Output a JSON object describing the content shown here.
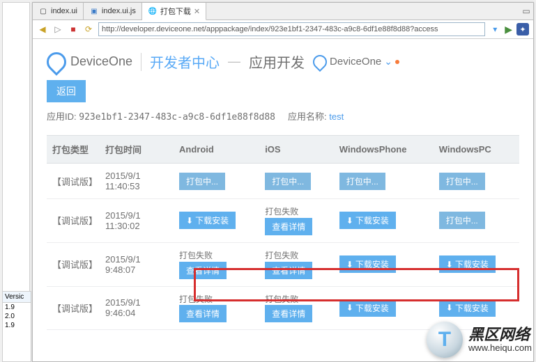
{
  "tabs": [
    {
      "label": "index.ui",
      "icon": "📄",
      "active": false
    },
    {
      "label": "index.ui.js",
      "icon": "📘",
      "active": false
    },
    {
      "label": "打包下载",
      "icon": "🌐",
      "active": true,
      "closable": true
    }
  ],
  "toolbar": {
    "url": "http://developer.deviceone.net/apppackage/index/923e1bf1-2347-483c-a9c8-6df1e88f8d88?access"
  },
  "header": {
    "brand": "DeviceOne",
    "dev_center": "开发者中心",
    "app_dev": "应用开发",
    "brand2": "DeviceOne"
  },
  "page": {
    "back_label": "返回",
    "app_id_label": "应用ID:",
    "app_id": "923e1bf1-2347-483c-a9c8-6df1e88f8d88",
    "app_name_label": "应用名称:",
    "app_name": "test"
  },
  "table": {
    "headers": [
      "打包类型",
      "打包时间",
      "Android",
      "iOS",
      "WindowsPhone",
      "WindowsPC"
    ],
    "rows": [
      {
        "type": "【调试版】",
        "time": "2015/9/1 11:40:53",
        "cells": [
          {
            "kind": "packing",
            "label": "打包中..."
          },
          {
            "kind": "packing",
            "label": "打包中..."
          },
          {
            "kind": "packing",
            "label": "打包中..."
          },
          {
            "kind": "packing",
            "label": "打包中..."
          }
        ],
        "highlighted": true
      },
      {
        "type": "【调试版】",
        "time": "2015/9/1 11:30:02",
        "cells": [
          {
            "kind": "download",
            "label": "下载安装"
          },
          {
            "kind": "fail",
            "label": "打包失败",
            "detail": "查看详情"
          },
          {
            "kind": "download",
            "label": "下载安装"
          },
          {
            "kind": "packing",
            "label": "打包中..."
          }
        ]
      },
      {
        "type": "【调试版】",
        "time": "2015/9/1 9:48:07",
        "cells": [
          {
            "kind": "fail",
            "label": "打包失败",
            "detail": "查看详情"
          },
          {
            "kind": "fail",
            "label": "打包失败",
            "detail": "查看详情"
          },
          {
            "kind": "download",
            "label": "下载安装"
          },
          {
            "kind": "download",
            "label": "下载安装"
          }
        ]
      },
      {
        "type": "【调试版】",
        "time": "2015/9/1 9:46:04",
        "cells": [
          {
            "kind": "fail",
            "label": "打包失败",
            "detail": "查看详情"
          },
          {
            "kind": "fail",
            "label": "打包失败",
            "detail": "查看详情"
          },
          {
            "kind": "download",
            "label": "下载安装"
          },
          {
            "kind": "download",
            "label": "下载安装"
          }
        ]
      }
    ]
  },
  "versions": {
    "header": "Versic",
    "items": [
      "1.9",
      "2.0",
      "1.9"
    ]
  },
  "overlay": {
    "brand": "黑区网络",
    "url": "www.heiqu.com"
  }
}
